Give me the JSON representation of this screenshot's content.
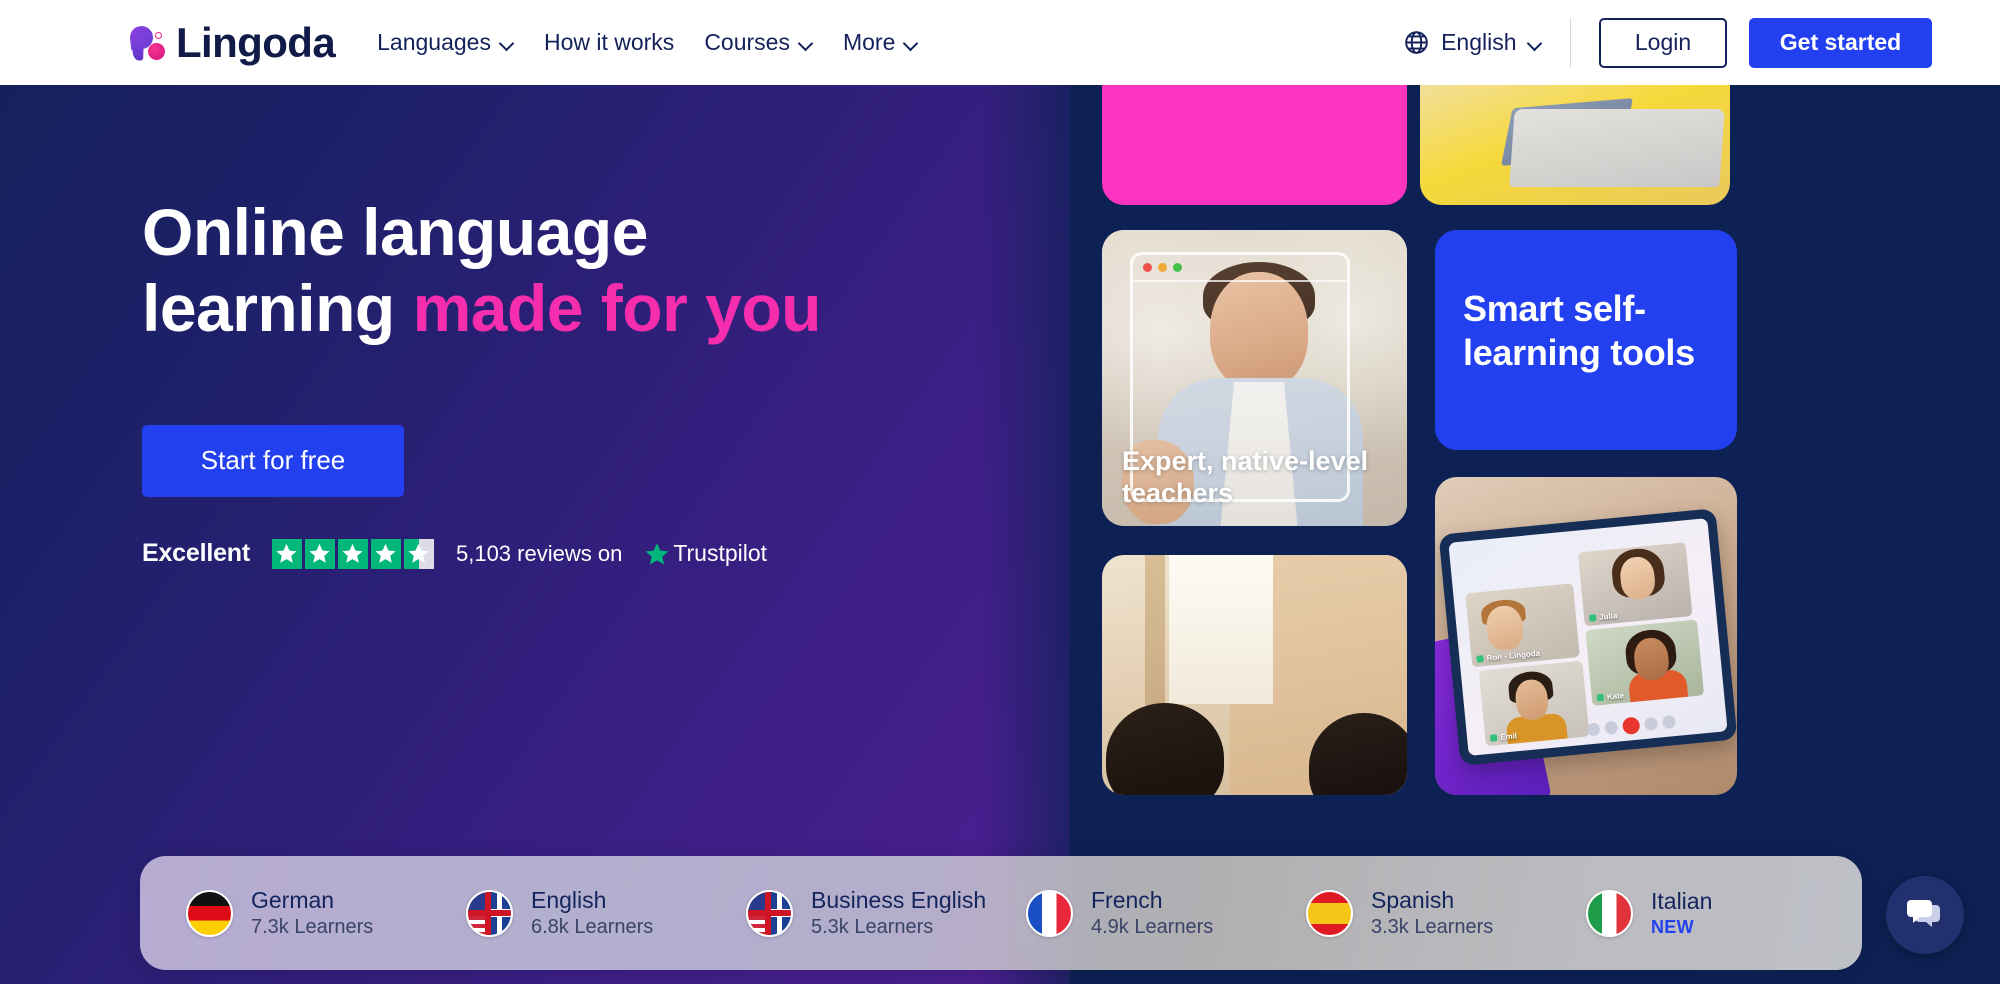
{
  "header": {
    "logo_text": "Lingoda",
    "nav": [
      {
        "label": "Languages",
        "has_dropdown": true
      },
      {
        "label": "How it works",
        "has_dropdown": false
      },
      {
        "label": "Courses",
        "has_dropdown": true
      },
      {
        "label": "More",
        "has_dropdown": true
      }
    ],
    "language_selector": "English",
    "login_label": "Login",
    "get_started_label": "Get started"
  },
  "hero": {
    "headline_line1": "Online language",
    "headline_line2_plain": "learning ",
    "headline_line2_accent": "made for you",
    "cta_label": "Start for free",
    "trustpilot": {
      "rating_word": "Excellent",
      "stars_full": 4,
      "stars_half": 1,
      "reviews_text": "5,103 reviews on",
      "brand": "Trustpilot"
    }
  },
  "collage": {
    "card_pink": {
      "label": ""
    },
    "card_laptop": {
      "label": ""
    },
    "card_teacher": {
      "caption_line1": "Expert, native-level",
      "caption_line2": "teachers"
    },
    "card_blue": {
      "title_line1": "Smart self-",
      "title_line2": "learning tools"
    },
    "card_street": {
      "label": ""
    },
    "card_tablet": {
      "participants": [
        "Ron - Lingoda",
        "Julia",
        "Kate",
        "Emil"
      ]
    }
  },
  "language_bar": [
    {
      "name": "German",
      "sub": "7.3k Learners",
      "flag": "flag-de",
      "is_new": false
    },
    {
      "name": "English",
      "sub": "6.8k Learners",
      "flag": "flag-en",
      "is_new": false
    },
    {
      "name": "Business English",
      "sub": "5.3k Learners",
      "flag": "flag-en",
      "is_new": false
    },
    {
      "name": "French",
      "sub": "4.9k Learners",
      "flag": "flag-fr",
      "is_new": false
    },
    {
      "name": "Spanish",
      "sub": "3.3k Learners",
      "flag": "flag-es",
      "is_new": false
    },
    {
      "name": "Italian",
      "sub": "NEW",
      "flag": "flag-it",
      "is_new": true
    }
  ],
  "chat_widget": {
    "icon": "chat-bubbles-icon"
  },
  "colors": {
    "brand_blue": "#2340f0",
    "brand_pink": "#f62dad",
    "card_pink": "#fb35c0",
    "navy": "#13225a",
    "right_panel_navy": "#0d2154",
    "trustpilot_green": "#00b67a",
    "new_badge": "#2340f0"
  }
}
